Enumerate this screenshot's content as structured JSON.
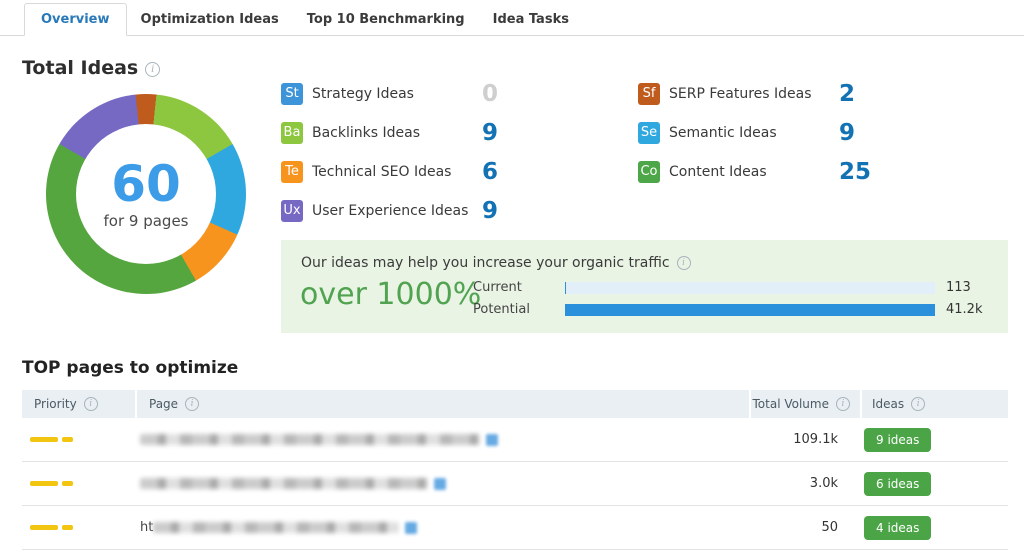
{
  "tabs": [
    {
      "label": "Overview",
      "active": true
    },
    {
      "label": "Optimization Ideas",
      "active": false
    },
    {
      "label": "Top 10 Benchmarking",
      "active": false
    },
    {
      "label": "Idea Tasks",
      "active": false
    }
  ],
  "total_ideas": {
    "title": "Total Ideas",
    "center_value": "60",
    "center_label": "for 9 pages"
  },
  "legend": {
    "left": [
      {
        "abbr": "St",
        "label": "Strategy Ideas",
        "count": "0",
        "color": "#3d94d9"
      },
      {
        "abbr": "Ba",
        "label": "Backlinks Ideas",
        "count": "9",
        "color": "#8dc63f"
      },
      {
        "abbr": "Te",
        "label": "Technical SEO Ideas",
        "count": "6",
        "color": "#f7941e"
      },
      {
        "abbr": "Ux",
        "label": "User Experience Ideas",
        "count": "9",
        "color": "#7569c4"
      }
    ],
    "right": [
      {
        "abbr": "Sf",
        "label": "SERP Features Ideas",
        "count": "2",
        "color": "#bf5b1d"
      },
      {
        "abbr": "Se",
        "label": "Semantic Ideas",
        "count": "9",
        "color": "#2fa8e0"
      },
      {
        "abbr": "Co",
        "label": "Content Ideas",
        "count": "25",
        "color": "#4da647"
      }
    ]
  },
  "banner": {
    "heading": "Our ideas may help you increase your organic traffic",
    "highlight": "over 1000%",
    "rows": [
      {
        "label": "Current",
        "value_label": "113"
      },
      {
        "label": "Potential",
        "value_label": "41.2k"
      }
    ]
  },
  "top_pages": {
    "title": "TOP pages to optimize",
    "columns": {
      "priority": "Priority",
      "page": "Page",
      "volume": "Total Volume",
      "ideas": "Ideas"
    },
    "rows": [
      {
        "url_masked": true,
        "url_prefix": "",
        "total_volume": "109.1k",
        "ideas_label": "9 ideas"
      },
      {
        "url_masked": true,
        "url_prefix": "",
        "total_volume": "3.0k",
        "ideas_label": "6 ideas"
      },
      {
        "url_masked": true,
        "url_prefix": "ht",
        "total_volume": "50",
        "ideas_label": "4 ideas"
      }
    ]
  },
  "chart_data": [
    {
      "type": "pie",
      "subtype": "donut",
      "title": "Total Ideas",
      "center_value": 60,
      "center_label": "for 9 pages",
      "start_angle_deg": -6,
      "segments": [
        {
          "label": "SERP Features Ideas",
          "value": 2,
          "color": "#bf5b1d"
        },
        {
          "label": "Backlinks Ideas",
          "value": 9,
          "color": "#8dc63f"
        },
        {
          "label": "Semantic Ideas",
          "value": 9,
          "color": "#2fa8e0"
        },
        {
          "label": "Technical SEO Ideas",
          "value": 6,
          "color": "#f7941e"
        },
        {
          "label": "Content Ideas",
          "value": 25,
          "color": "#55a63f"
        },
        {
          "label": "User Experience Ideas",
          "value": 9,
          "color": "#7569c4"
        }
      ],
      "note": "Strategy Ideas = 0 (not drawn)"
    },
    {
      "type": "bar",
      "orientation": "horizontal",
      "categories": [
        "Current",
        "Potential"
      ],
      "values": [
        113,
        41200
      ],
      "value_labels": [
        "113",
        "41.2k"
      ],
      "xlim": [
        0,
        41200
      ],
      "bar_color": "#2b90db",
      "track_color": "#e3eff8"
    }
  ]
}
